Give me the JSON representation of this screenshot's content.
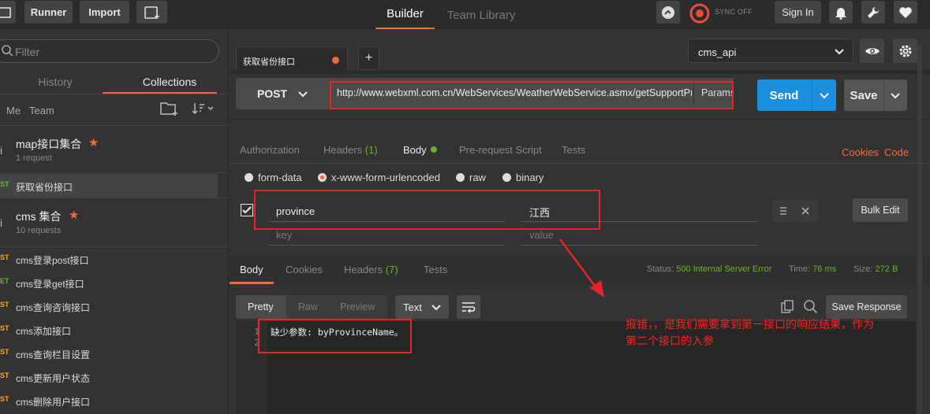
{
  "topbar": {
    "runner_label": "Runner",
    "import_label": "Import",
    "tabs": [
      {
        "label": "Builder",
        "active": true
      },
      {
        "label": "Team Library",
        "active": false
      }
    ],
    "sync_label": "SYNC OFF",
    "sign_in_label": "Sign In",
    "accent_color": "#f26b3a"
  },
  "sidebar": {
    "filter_placeholder": "Filter",
    "tabs": [
      "History",
      "Collections"
    ],
    "scope": [
      "Me",
      "Team"
    ],
    "collections": [
      {
        "name": "map接口集合",
        "count": "1 request",
        "starred": true
      },
      {
        "name": "cms 集合",
        "count": "10 requests",
        "starred": true
      }
    ],
    "requests": [
      {
        "method": "ST",
        "name": "获取省份接口",
        "selected": true,
        "color": "#6fb12e"
      },
      {
        "method": "ST",
        "name": "cms登录post接口",
        "color": "#f6a623"
      },
      {
        "method": "ET",
        "name": "cms登录get接口",
        "color": "#6fb12e"
      },
      {
        "method": "ST",
        "name": "cms查询咨询接口",
        "color": "#f6a623"
      },
      {
        "method": "ST",
        "name": "cms添加接口",
        "color": "#f6a623"
      },
      {
        "method": "ST",
        "name": "cms查询栏目设置",
        "color": "#f6a623"
      },
      {
        "method": "ST",
        "name": "cms更新用户状态",
        "color": "#f6a623"
      },
      {
        "method": "ST",
        "name": "cms删除用户接口",
        "color": "#f6a623"
      }
    ]
  },
  "request_tab": {
    "label": "获取省份接口",
    "new_tab": "+"
  },
  "environment": {
    "selected": "cms_api"
  },
  "request": {
    "method": "POST",
    "url": "http://www.webxml.com.cn/WebServices/WeatherWebService.asmx/getSupportProvince",
    "params_label": "Params",
    "send_label": "Send",
    "save_label": "Save"
  },
  "request_subtabs": [
    {
      "label": "Authorization",
      "active": false
    },
    {
      "label": "Headers",
      "count": "(1)",
      "active": false
    },
    {
      "label": "Body",
      "active": true
    },
    {
      "label": "Pre-request Script",
      "active": false
    },
    {
      "label": "Tests",
      "active": false
    }
  ],
  "links": {
    "cookies": "Cookies",
    "code": "Code"
  },
  "body_types": [
    {
      "label": "form-data",
      "selected": false
    },
    {
      "label": "x-www-form-urlencoded",
      "selected": true
    },
    {
      "label": "raw",
      "selected": false
    },
    {
      "label": "binary",
      "selected": false
    }
  ],
  "form": {
    "key": "province",
    "value": "江西",
    "key_placeholder": "key",
    "value_placeholder": "value",
    "bulk_edit_label": "Bulk Edit"
  },
  "response": {
    "tabs": [
      {
        "label": "Body",
        "active": true
      },
      {
        "label": "Cookies",
        "active": false
      },
      {
        "label": "Headers",
        "count": "(7)",
        "active": false
      },
      {
        "label": "Tests",
        "active": false
      }
    ],
    "status_label": "Status:",
    "status_value": "500 Internal Server Error",
    "time_label": "Time:",
    "time_value": "76 ms",
    "size_label": "Size:",
    "size_value": "272 B",
    "view_modes": [
      "Pretty",
      "Raw",
      "Preview"
    ],
    "format": "Text",
    "save_response_label": "Save Response",
    "lines": [
      {
        "num": "1",
        "text": "缺少参数: byProvinceName。"
      },
      {
        "num": "2",
        "text": ""
      }
    ]
  },
  "annotation": {
    "text_line1": "报错，，是我们需要拿到第一接口的响应结果，作为",
    "text_line2": "第二个接口的入参",
    "color": "#ff2020"
  }
}
